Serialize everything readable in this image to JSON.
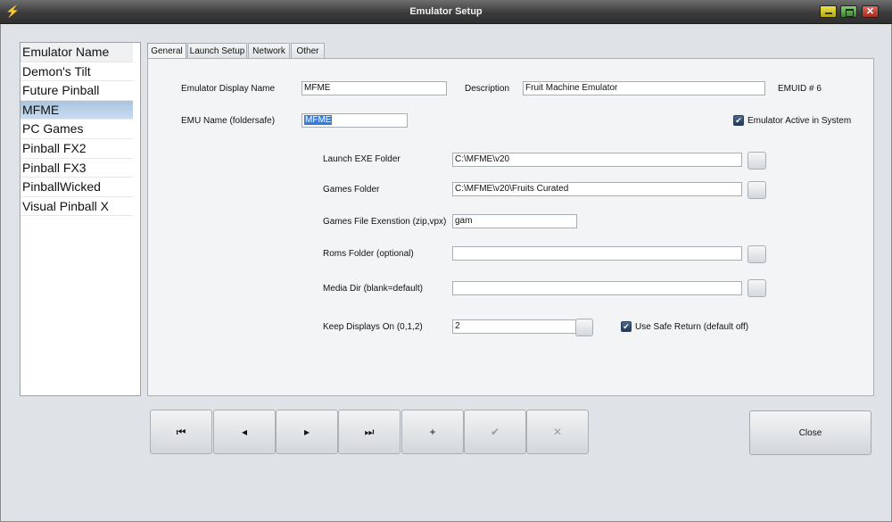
{
  "window": {
    "title": "Emulator Setup",
    "close_glyph": "✕",
    "app_icon": "pinball-flipper-icon"
  },
  "emulator_list": {
    "items": [
      "Emulator Name",
      "Demon's Tilt",
      "Future Pinball",
      "MFME",
      "PC Games",
      "Pinball FX2",
      "Pinball FX3",
      "PinballWicked",
      "Visual Pinball X"
    ],
    "selected": "MFME"
  },
  "tabs": [
    "General",
    "Launch Setup",
    "Network",
    "Other"
  ],
  "active_tab": "General",
  "general": {
    "display_name_label": "Emulator Display Name",
    "display_name_value": "MFME",
    "description_label": "Description",
    "description_value": "Fruit Machine Emulator",
    "emuid_label": "EMUID #",
    "emuid_value": "6",
    "emu_name_label": "EMU Name (foldersafe)",
    "emu_name_value": "MFME",
    "active_label": "Emulator Active in System",
    "active_checked": true,
    "launch_exe_label": "Launch EXE Folder",
    "launch_exe_value": "C:\\MFME\\v20",
    "games_folder_label": "Games Folder",
    "games_folder_value": "C:\\MFME\\v20\\Fruits Curated",
    "games_ext_label": "Games File Exenstion (zip,vpx)",
    "games_ext_value": "gam",
    "roms_folder_label": "Roms Folder (optional)",
    "roms_folder_value": "",
    "media_dir_label": "Media Dir (blank=default)",
    "media_dir_value": "",
    "keep_displays_label": "Keep Displays On (0,1,2)",
    "keep_displays_value": "2",
    "safe_return_label": "Use Safe Return (default off)",
    "safe_return_checked": true
  },
  "navigation": {
    "first": "⏮",
    "prev": "◂",
    "next": "▸",
    "last": "⏭",
    "add": "+",
    "post": "✔",
    "cancel": "✕"
  },
  "close_label": "Close",
  "check_glyph": "✔"
}
